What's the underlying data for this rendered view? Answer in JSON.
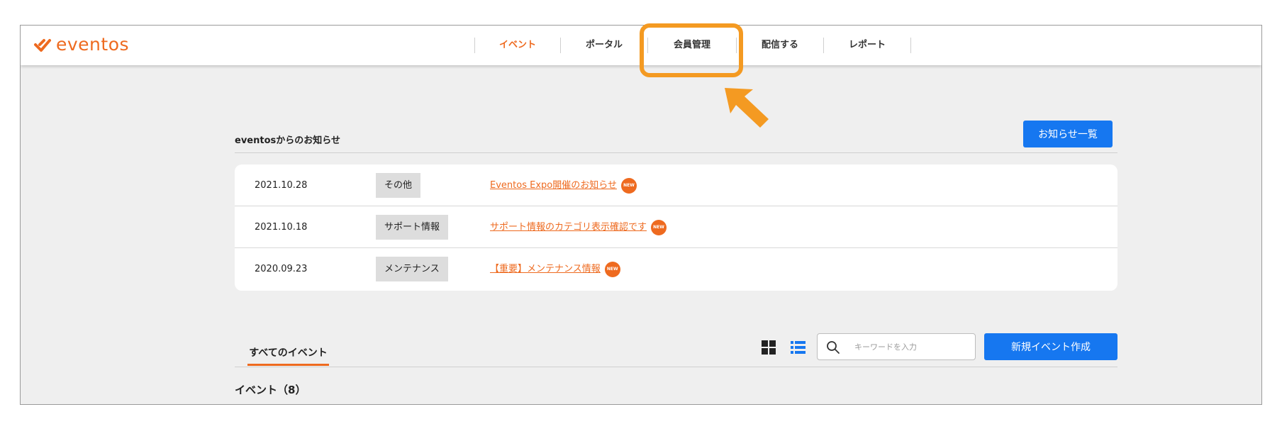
{
  "header": {
    "logo_text": "eventos",
    "nav": [
      {
        "label": "イベント",
        "active": true
      },
      {
        "label": "ポータル",
        "active": false
      },
      {
        "label": "会員管理",
        "active": false
      },
      {
        "label": "配信する",
        "active": false
      },
      {
        "label": "レポート",
        "active": false
      }
    ]
  },
  "announcements": {
    "title": "eventosからのお知らせ",
    "list_button": "お知らせ一覧",
    "items": [
      {
        "date": "2021.10.28",
        "category": "その他",
        "title": "Eventos Expo開催のお知らせ",
        "badge": "NEW"
      },
      {
        "date": "2021.10.18",
        "category": "サポート情報",
        "title": "サポート情報のカテゴリ表示確認です",
        "badge": "NEW"
      },
      {
        "date": "2020.09.23",
        "category": "メンテナンス",
        "title": "【重要】メンテナンス情報",
        "badge": "NEW"
      }
    ]
  },
  "events": {
    "tab_label": "すべてのイベント",
    "count_label": "イベント（8）",
    "search_placeholder": "キーワードを入力",
    "new_button": "新規イベント作成"
  },
  "colors": {
    "accent": "#ee6a1f",
    "primary_button": "#1677f0",
    "highlight": "#f49a22"
  },
  "icons": [
    "eventos-logo-icon",
    "highlight-arrow-icon",
    "grid-view-icon",
    "list-view-icon",
    "search-icon"
  ]
}
